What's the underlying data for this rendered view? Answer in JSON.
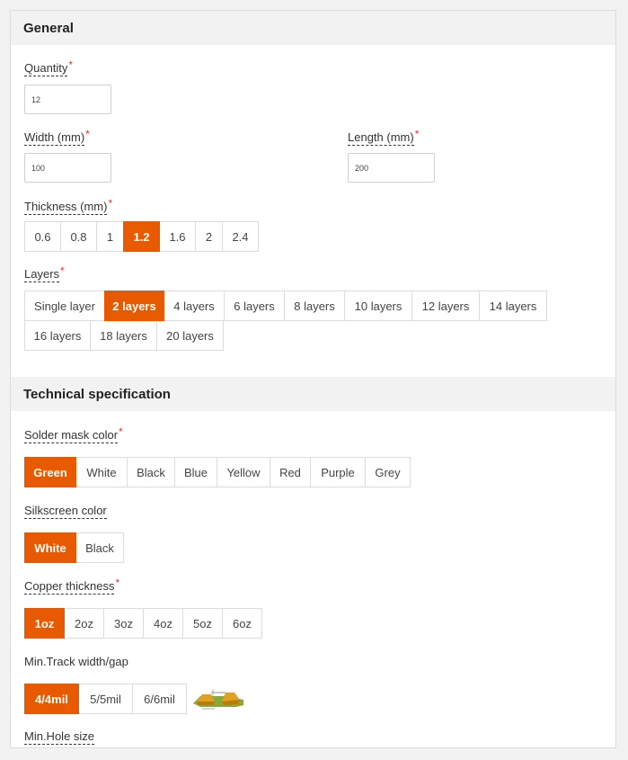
{
  "general": {
    "title": "General",
    "quantity": {
      "label": "Quantity",
      "value": "12"
    },
    "width": {
      "label": "Width (mm)",
      "value": "100"
    },
    "length": {
      "label": "Length (mm)",
      "value": "200"
    },
    "thickness": {
      "label": "Thickness (mm)",
      "options": [
        "0.6",
        "0.8",
        "1",
        "1.2",
        "1.6",
        "2",
        "2.4"
      ],
      "selected": "1.2"
    },
    "layers": {
      "label": "Layers",
      "options_row1": [
        "Single layer",
        "2 layers",
        "4 layers",
        "6 layers",
        "8 layers",
        "10 layers",
        "12 layers",
        "14 layers"
      ],
      "options_row2": [
        "16 layers",
        "18 layers",
        "20 layers"
      ],
      "selected": "2 layers"
    }
  },
  "technical": {
    "title": "Technical specification",
    "solder_mask": {
      "label": "Solder mask color",
      "options": [
        "Green",
        "White",
        "Black",
        "Blue",
        "Yellow",
        "Red",
        "Purple",
        "Grey"
      ],
      "selected": "Green"
    },
    "silkscreen": {
      "label": "Silkscreen color",
      "options": [
        "White",
        "Black"
      ],
      "selected": "White"
    },
    "copper": {
      "label": "Copper thickness",
      "options": [
        "1oz",
        "2oz",
        "3oz",
        "4oz",
        "5oz",
        "6oz"
      ],
      "selected": "1oz"
    },
    "track": {
      "label": "Min.Track width/gap",
      "options": [
        "4/4mil",
        "5/5mil",
        "6/6mil"
      ],
      "selected": "4/4mil"
    },
    "hole": {
      "label": "Min.Hole size"
    }
  },
  "colors": {
    "accent": "#e85a00",
    "required": "#e33333"
  }
}
